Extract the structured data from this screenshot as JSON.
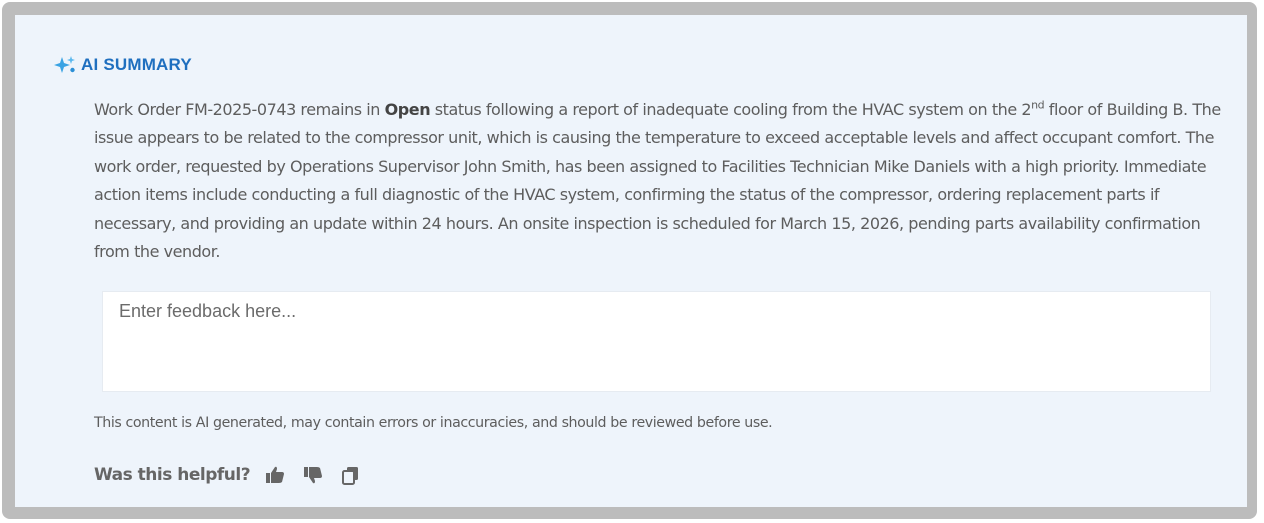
{
  "header": {
    "title": "AI SUMMARY",
    "icon": "sparkle-icon",
    "title_color": "#1f6fbf"
  },
  "summary": {
    "part1": "Work Order FM-2025-0743 remains in ",
    "status": "Open",
    "part2": " status following a report of inadequate cooling from the HVAC system on the 2",
    "superscript": "nd",
    "part3": " floor of Building B. The issue appears to be related to the compressor unit, which is causing the temperature to exceed acceptable levels and affect occupant comfort. The work order, requested by Operations Supervisor John Smith, has been assigned to Facilities Technician Mike Daniels with a high priority. Immediate action items include conducting a full diagnostic of the HVAC system, confirming the status of the compressor, ordering replacement parts if necessary, and providing an update within 24 hours. An onsite inspection is scheduled for March 15, 2026, pending parts availability confirmation from the vendor."
  },
  "feedback": {
    "placeholder": "Enter feedback here...",
    "value": ""
  },
  "disclaimer": "This content is AI generated, may contain errors or inaccuracies, and should be reviewed before use.",
  "helpful": {
    "label": "Was this helpful?",
    "icons": [
      "thumbs-up-icon",
      "thumbs-down-icon",
      "copy-icon"
    ]
  }
}
